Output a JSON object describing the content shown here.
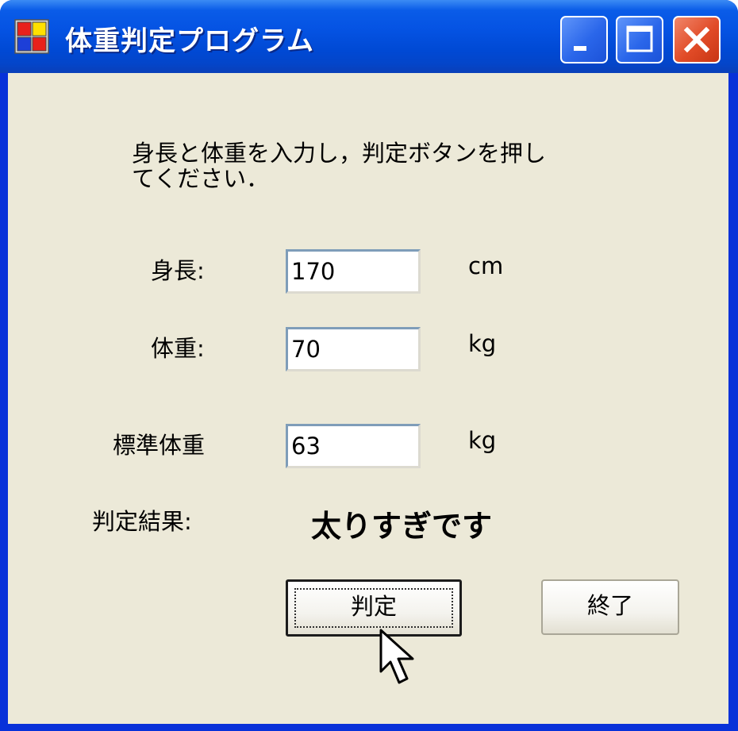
{
  "window": {
    "title": "体重判定プログラム",
    "icon": "app-icon",
    "controls": [
      "minimize-icon",
      "maximize-icon",
      "close-icon"
    ]
  },
  "instruction": {
    "line1": "身長と体重を入力し，判定ボタンを押し",
    "line2": "てください．"
  },
  "height": {
    "label": "身長:",
    "value": "170",
    "unit": "cm"
  },
  "weight": {
    "label": "体重:",
    "value": "70",
    "unit": "kg"
  },
  "standard_weight": {
    "label": "標準体重",
    "value": "63",
    "unit": "kg"
  },
  "result": {
    "label": "判定結果:",
    "value": "太りすぎです"
  },
  "buttons": {
    "judge": "判定",
    "exit": "終了"
  },
  "colors": {
    "titlebar": "#0553e3",
    "client": "#ece9d8",
    "close": "#e14b27"
  }
}
